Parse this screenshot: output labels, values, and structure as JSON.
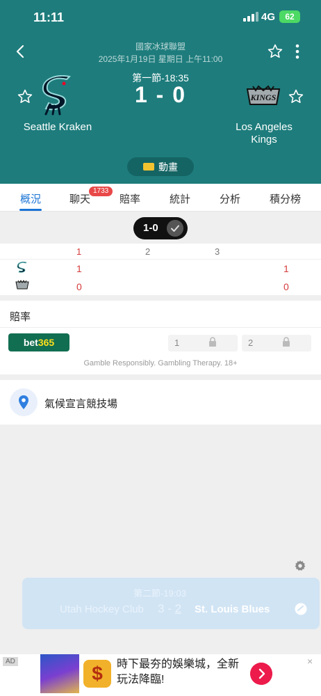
{
  "status_bar": {
    "time": "11:11",
    "network": "4G",
    "battery": "62"
  },
  "match": {
    "league": "國家冰球聯盟",
    "datetime": "2025年1月19日 星期日 上午11:00",
    "period_clock": "第一節-18:35",
    "score": "1 - 0",
    "home_team": "Seattle Kraken",
    "away_team": "Los Angeles Kings",
    "animation_label": "動畫"
  },
  "tabs": [
    {
      "label": "概況",
      "active": true
    },
    {
      "label": "聊天",
      "badge": "1733"
    },
    {
      "label": "賠率"
    },
    {
      "label": "統計"
    },
    {
      "label": "分析"
    },
    {
      "label": "積分榜"
    }
  ],
  "score_toggle": {
    "label": "1-0"
  },
  "period_scores": {
    "headers": [
      "1",
      "2",
      "3"
    ],
    "home": {
      "p1": "1",
      "total": "1"
    },
    "away": {
      "p1": "0",
      "total": "0"
    }
  },
  "odds": {
    "title": "賠率",
    "bookmaker_part1": "bet",
    "bookmaker_part2": "365",
    "option1": "1",
    "option2": "2",
    "disclaimer": "Gamble Responsibly. Gambling Therapy. 18+"
  },
  "venue": {
    "name": "氣候宣言競技場"
  },
  "other_match": {
    "period_clock": "第二節-19:03",
    "home_team": "Utah Hockey Club",
    "score_home": "3",
    "score_sep": " - ",
    "score_away": "2",
    "away_team": "St. Louis Blues"
  },
  "ad": {
    "tag": "AD",
    "text": "時下最夯的娛樂城，全新玩法降臨!",
    "close": "×"
  },
  "colors": {
    "header_bg": "#1e7c7c",
    "tab_active": "#1a74d6",
    "score_red": "#d63a3a",
    "ad_cta": "#ec1b4b"
  }
}
